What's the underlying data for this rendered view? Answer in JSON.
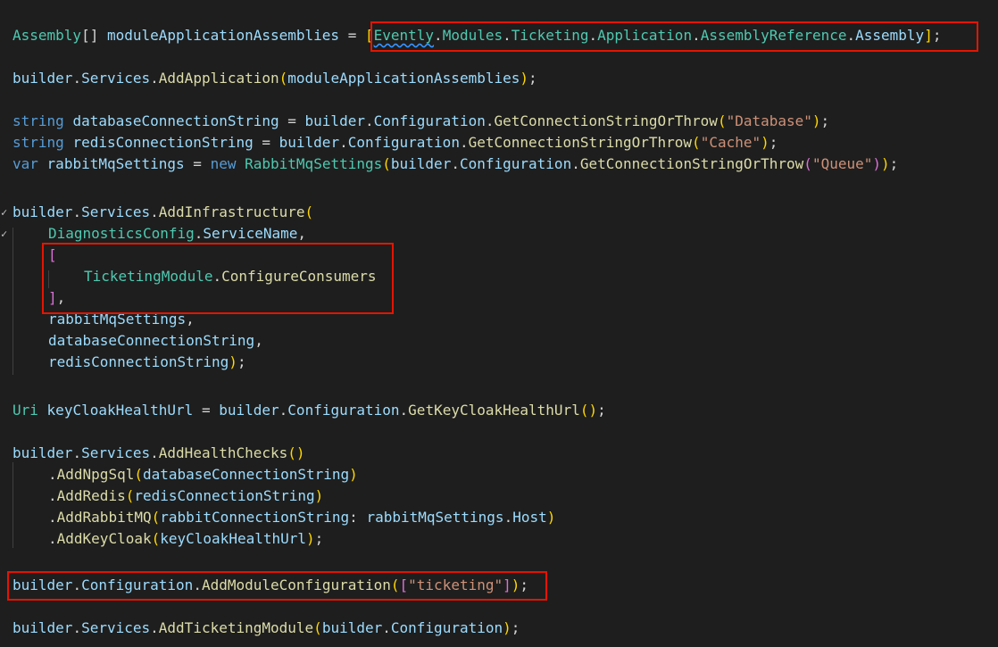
{
  "code": {
    "l1": {
      "type": "Assembly",
      "arr": "[]",
      "name": "moduleApplicationAssemblies",
      "eq": " = ",
      "ob": "[",
      "ns1": "Evently",
      "dot1": ".",
      "ns2": "Modules",
      "dot2": ".",
      "ns3": "Ticketing",
      "dot3": ".",
      "ns4": "Application",
      "dot4": ".",
      "cls": "AssemblyReference",
      "dot5": ".",
      "prop": "Assembly",
      "cb": "]",
      "end": ";"
    },
    "l2": {
      "obj": "builder",
      "d1": ".",
      "svc": "Services",
      "d2": ".",
      "meth": "AddApplication",
      "op": "(",
      "arg": "moduleApplicationAssemblies",
      "cp": ")",
      "end": ";"
    },
    "l3": {
      "kw": "string",
      "name": "databaseConnectionString",
      "eq": " = ",
      "obj": "builder",
      "d1": ".",
      "cfg": "Configuration",
      "d2": ".",
      "meth": "GetConnectionStringOrThrow",
      "op": "(",
      "str": "\"Database\"",
      "cp": ")",
      "end": ";"
    },
    "l4": {
      "kw": "string",
      "name": "redisConnectionString",
      "eq": " = ",
      "obj": "builder",
      "d1": ".",
      "cfg": "Configuration",
      "d2": ".",
      "meth": "GetConnectionStringOrThrow",
      "op": "(",
      "str": "\"Cache\"",
      "cp": ")",
      "end": ";"
    },
    "l5": {
      "kw": "var",
      "name": "rabbitMqSettings",
      "eq": " = ",
      "nw": "new",
      "cls": "RabbitMqSettings",
      "op": "(",
      "obj": "builder",
      "d1": ".",
      "cfg": "Configuration",
      "d2": ".",
      "meth": "GetConnectionStringOrThrow",
      "op2": "(",
      "str": "\"Queue\"",
      "cp2": ")",
      "cp": ")",
      "end": ";"
    },
    "l6": {
      "obj": "builder",
      "d1": ".",
      "svc": "Services",
      "d2": ".",
      "meth": "AddInfrastructure",
      "op": "("
    },
    "l7": {
      "cls": "DiagnosticsConfig",
      "d": ".",
      "prop": "ServiceName",
      "c": ","
    },
    "l8": {
      "ob": "["
    },
    "l9": {
      "cls": "TicketingModule",
      "d": ".",
      "meth": "ConfigureConsumers"
    },
    "l10": {
      "cb": "]",
      "c": ","
    },
    "l11": {
      "name": "rabbitMqSettings",
      "c": ","
    },
    "l12": {
      "name": "databaseConnectionString",
      "c": ","
    },
    "l13": {
      "name": "redisConnectionString",
      "cp": ")",
      "end": ";"
    },
    "l14": {
      "cls": "Uri",
      "name": "keyCloakHealthUrl",
      "eq": " = ",
      "obj": "builder",
      "d1": ".",
      "cfg": "Configuration",
      "d2": ".",
      "meth": "GetKeyCloakHealthUrl",
      "op": "(",
      "cp": ")",
      "end": ";"
    },
    "l15": {
      "obj": "builder",
      "d1": ".",
      "svc": "Services",
      "d2": ".",
      "meth": "AddHealthChecks",
      "op": "(",
      "cp": ")"
    },
    "l16": {
      "d": ".",
      "meth": "AddNpgSql",
      "op": "(",
      "arg": "databaseConnectionString",
      "cp": ")"
    },
    "l17": {
      "d": ".",
      "meth": "AddRedis",
      "op": "(",
      "arg": "redisConnectionString",
      "cp": ")"
    },
    "l18": {
      "d": ".",
      "meth": "AddRabbitMQ",
      "op": "(",
      "pname": "rabbitConnectionString",
      "colon": ": ",
      "obj": "rabbitMqSettings",
      "d2": ".",
      "prop": "Host",
      "cp": ")"
    },
    "l19": {
      "d": ".",
      "meth": "AddKeyCloak",
      "op": "(",
      "arg": "keyCloakHealthUrl",
      "cp": ")",
      "end": ";"
    },
    "l20": {
      "obj": "builder",
      "d1": ".",
      "cfg": "Configuration",
      "d2": ".",
      "meth": "AddModuleConfiguration",
      "op": "(",
      "ob": "[",
      "str": "\"ticketing\"",
      "cb": "]",
      "cp": ")",
      "end": ";"
    },
    "l21": {
      "obj": "builder",
      "d1": ".",
      "svc": "Services",
      "d2": ".",
      "meth": "AddTicketingModule",
      "op": "(",
      "arg1": "builder",
      "d3": ".",
      "arg2": "Configuration",
      "cp": ")",
      "end": ";"
    }
  },
  "gutter": {
    "fold1": "✓",
    "fold2": "✓"
  },
  "colors": {
    "background": "#1e1e1e",
    "type": "#4ec9b0",
    "variable": "#9cdcfe",
    "method": "#dcdcaa",
    "keyword": "#569cd6",
    "string": "#ce9178",
    "highlight_box": "#e51400"
  }
}
